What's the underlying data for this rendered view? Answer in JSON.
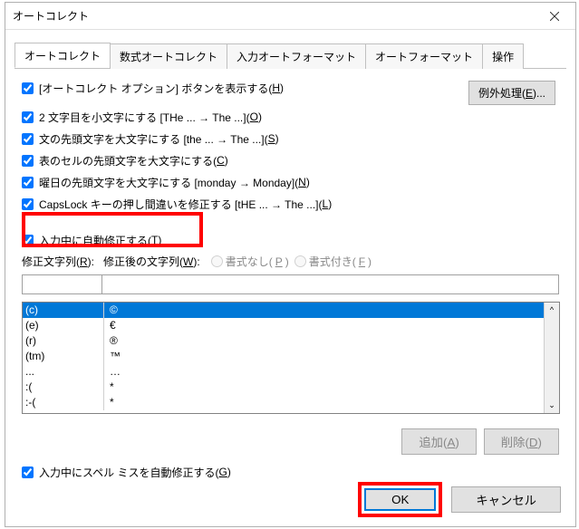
{
  "window": {
    "title": "オートコレクト"
  },
  "tabs": [
    {
      "label": "オートコレクト",
      "active": true
    },
    {
      "label": "数式オートコレクト"
    },
    {
      "label": "入力オートフォーマット"
    },
    {
      "label": "オートフォーマット"
    },
    {
      "label": "操作"
    }
  ],
  "options": {
    "show_button": {
      "text": "[オートコレクト オプション] ボタンを表示する(",
      "accel": "H",
      "checked": true
    },
    "two_caps": {
      "text": "2 文字目を小文字にする [THe ... → The ...](",
      "accel": "O",
      "checked": true
    },
    "cap_first": {
      "text": "文の先頭文字を大文字にする [the ... → The ...](",
      "accel": "S",
      "checked": true
    },
    "cap_table": {
      "text": "表のセルの先頭文字を大文字にする(",
      "accel": "C",
      "checked": true
    },
    "cap_weekday": {
      "text": "曜日の先頭文字を大文字にする [monday → Monday](",
      "accel": "N",
      "checked": true
    },
    "capslock": {
      "text": "CapsLock キーの押し間違いを修正する [tHE ... → The ...](",
      "accel": "L",
      "checked": true
    },
    "auto_replace": {
      "text": "入力中に自動修正する(",
      "accel": "T",
      "checked": true
    },
    "spell": {
      "text": "入力中にスペル ミスを自動修正する(",
      "accel": "G",
      "checked": true
    }
  },
  "exception_btn": {
    "pre": "例外処理(",
    "accel": "E",
    "post": ")..."
  },
  "labels": {
    "replace_pre": "修正文字列(",
    "replace_accel": "R",
    "replace_post": "):",
    "with_pre": "修正後の文字列(",
    "with_accel": "W",
    "with_post": "):",
    "plain_pre": "書式なし(",
    "plain_accel": "P",
    "plain_post": ")",
    "fmt_pre": "書式付き(",
    "fmt_accel": "F",
    "fmt_post": ")"
  },
  "table": [
    {
      "k": "(c)",
      "v": "©"
    },
    {
      "k": "(e)",
      "v": "€"
    },
    {
      "k": "(r)",
      "v": "®"
    },
    {
      "k": "(tm)",
      "v": "™"
    },
    {
      "k": "...",
      "v": "…"
    },
    {
      "k": ":(",
      "v": "*"
    },
    {
      "k": ":-(",
      "v": "*"
    }
  ],
  "buttons": {
    "add_pre": "追加(",
    "add_accel": "A",
    "add_post": ")",
    "del_pre": "削除(",
    "del_accel": "D",
    "del_post": ")",
    "ok": "OK",
    "cancel": "キャンセル"
  }
}
